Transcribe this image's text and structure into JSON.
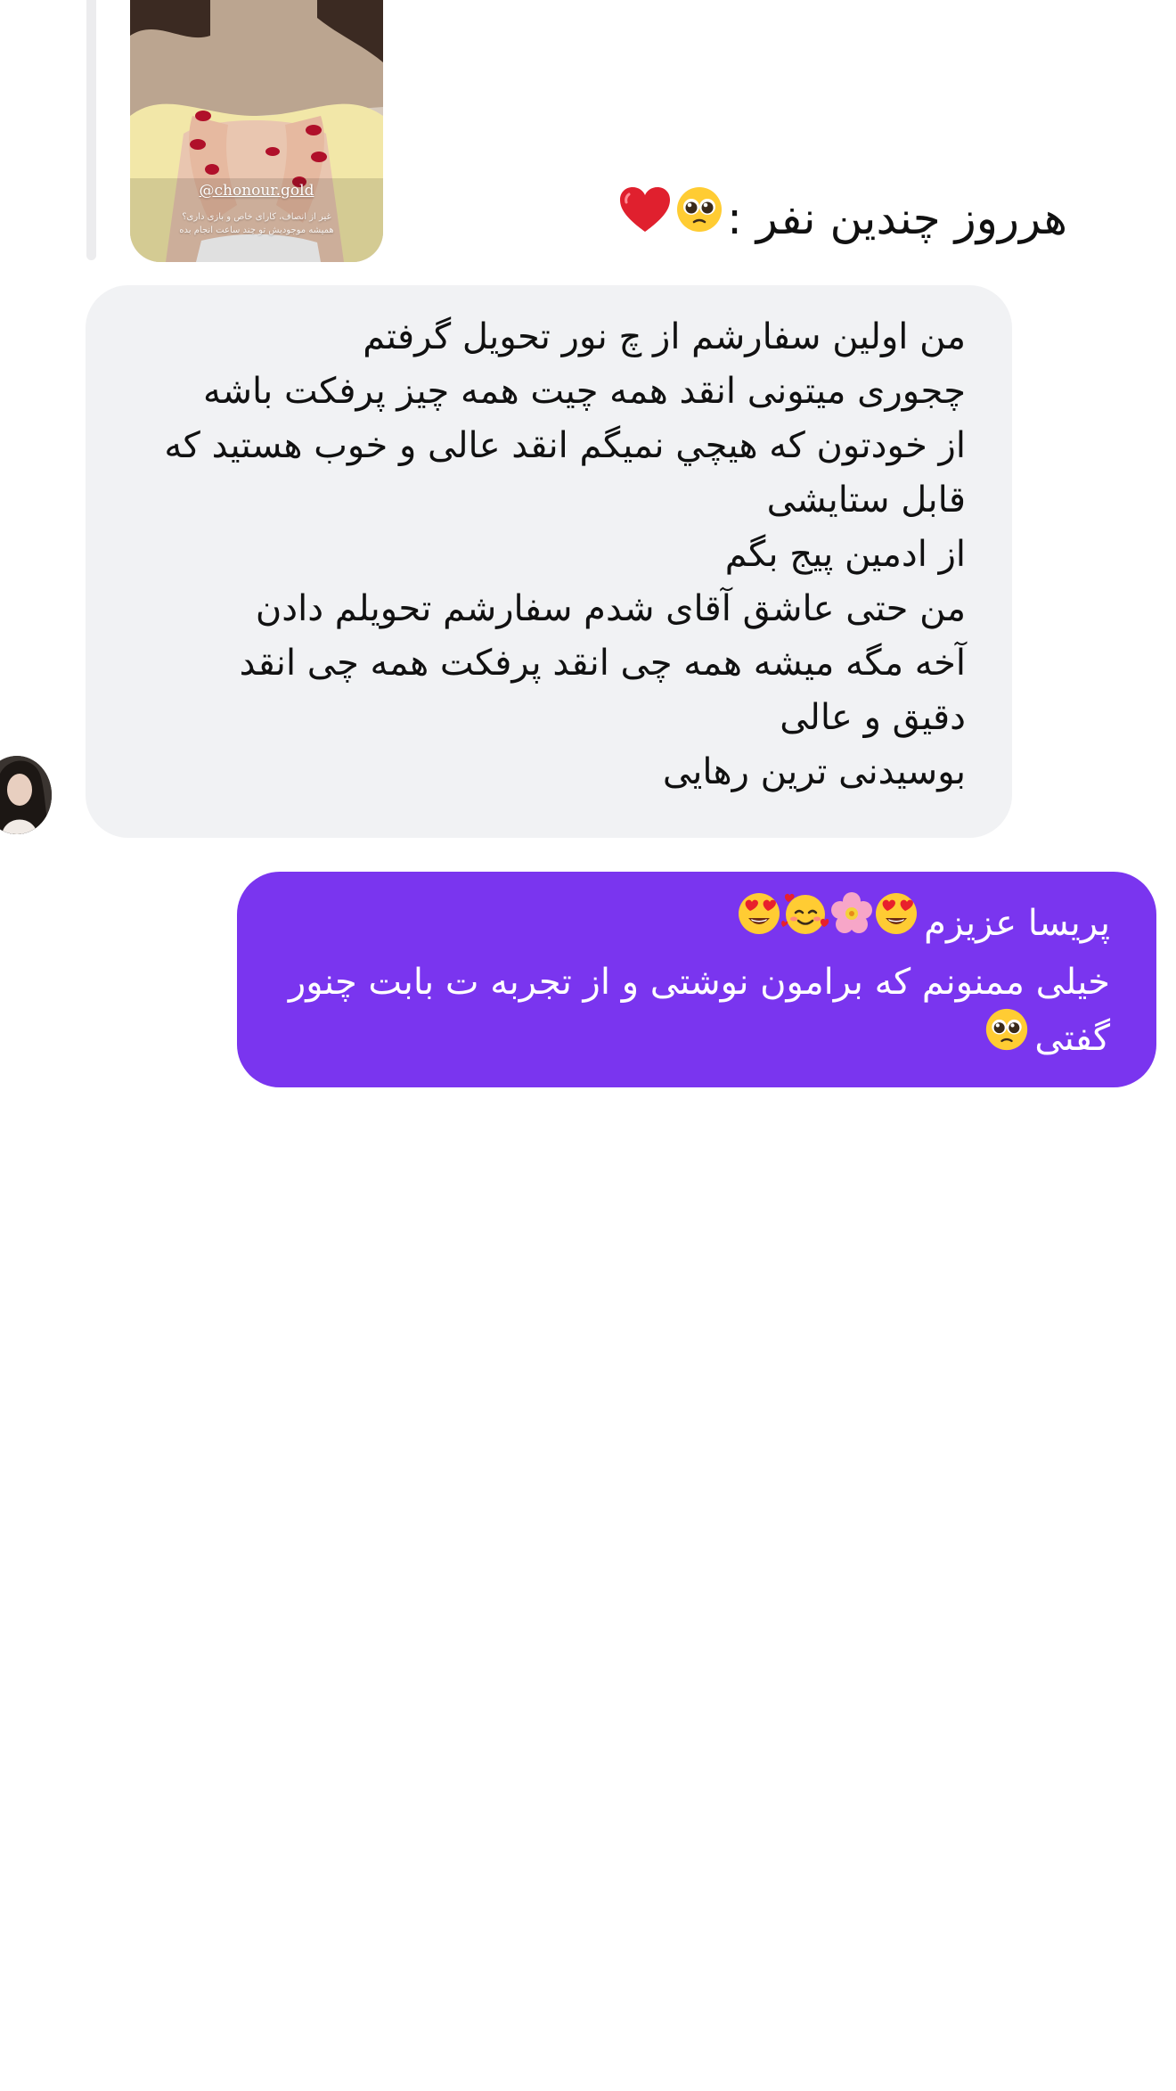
{
  "shared_story": {
    "handle": "@chonour.gold",
    "caption_line_1": "غیر از انصاف، کارای خاص و بازی داری؟",
    "caption_line_2": "همیشه موجودیش تو چند ساعت انجام بده",
    "overlay_text": "هرروز چندین نفر :",
    "overlay_emojis": [
      "pleading-face-emoji",
      "red-heart-emoji"
    ]
  },
  "incoming_message": {
    "lines": [
      "من اولین سفارشم از چ نور تحویل گرفتم",
      "چجوری میتونی انقد همه چیت همه چیز پرفکت باشه",
      "از خودتون که هیچي نمیگم انقد عالی و خوب هستید که",
      "قابل ستایشی",
      "از ادمین پیج بگم",
      "من حتی عاشق آقای شدم سفارشم تحویلم دادن",
      "آخه مگه میشه همه چی انقد پرفکت همه چی انقد",
      "دقیق و عالی",
      "بوسیدنی ترین رهایی"
    ]
  },
  "outgoing_message": {
    "line_1_text": "پریسا عزیزم",
    "line_1_emojis": [
      "heart-eyes-emoji",
      "cherry-blossom-emoji",
      "smiling-hearts-emoji",
      "heart-eyes-emoji"
    ],
    "line_2": "خیلی ممنونم که برامون نوشتی و از تجربه ت بابت چنور",
    "line_3_text": "گفتی",
    "line_3_emoji": "pleading-face-emoji"
  },
  "colors": {
    "incoming_bubble": "#f1f2f4",
    "outgoing_bubble": "#7a35ef",
    "background": "#ffffff"
  }
}
